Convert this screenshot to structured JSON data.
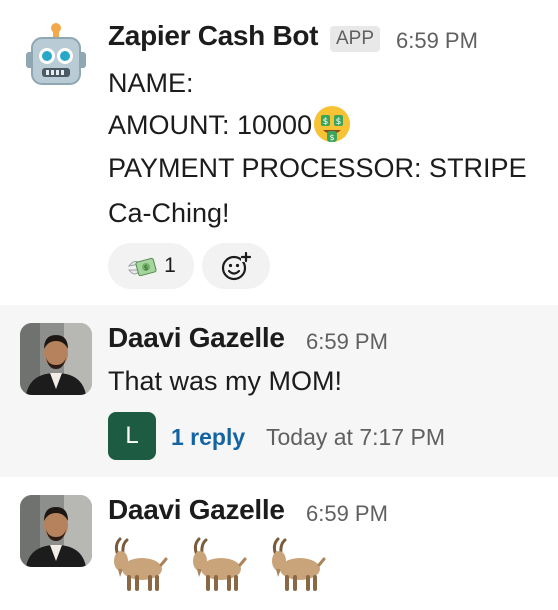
{
  "messages": [
    {
      "sender": "Zapier Cash Bot",
      "tag": "APP",
      "time": "6:59 PM",
      "lines": [
        "NAME:",
        "AMOUNT: 10000",
        "PAYMENT PROCESSOR: STRIPE",
        "Ca-Ching!"
      ],
      "amount_emoji": "money-mouth-face-icon",
      "reactions": [
        {
          "emoji": "money-with-wings-icon",
          "count": "1"
        }
      ],
      "add_reaction_icon": "add-reaction-icon"
    },
    {
      "sender": "Daavi Gazelle",
      "time": "6:59 PM",
      "text": "That was my MOM!",
      "thread": {
        "avatar_letter": "L",
        "reply_label": "1 reply",
        "reply_time": "Today at 7:17 PM"
      }
    },
    {
      "sender": "Daavi Gazelle",
      "time": "6:59 PM",
      "emojis": [
        "goat-icon",
        "goat-icon",
        "goat-icon"
      ]
    }
  ],
  "colors": {
    "link": "#1264a3",
    "thread_avatar": "#1e5b43",
    "highlight": "#f6f6f6"
  }
}
